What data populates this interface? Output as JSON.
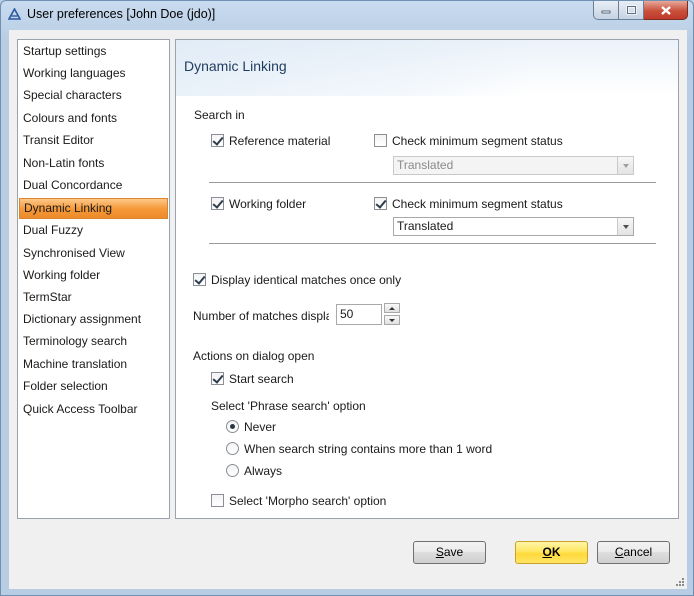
{
  "window": {
    "title": "User preferences [John Doe (jdo)]"
  },
  "sidebar": {
    "items": [
      {
        "label": "Startup settings",
        "selected": false
      },
      {
        "label": "Working languages",
        "selected": false
      },
      {
        "label": "Special characters",
        "selected": false
      },
      {
        "label": "Colours and fonts",
        "selected": false
      },
      {
        "label": "Transit Editor",
        "selected": false
      },
      {
        "label": "Non-Latin fonts",
        "selected": false
      },
      {
        "label": "Dual Concordance",
        "selected": false
      },
      {
        "label": "Dynamic Linking",
        "selected": true
      },
      {
        "label": "Dual Fuzzy",
        "selected": false
      },
      {
        "label": "Synchronised View",
        "selected": false
      },
      {
        "label": "Working folder",
        "selected": false
      },
      {
        "label": "TermStar",
        "selected": false
      },
      {
        "label": "Dictionary assignment",
        "selected": false
      },
      {
        "label": "Terminology search",
        "selected": false
      },
      {
        "label": "Machine translation",
        "selected": false
      },
      {
        "label": "Folder selection",
        "selected": false
      },
      {
        "label": "Quick Access Toolbar",
        "selected": false
      }
    ]
  },
  "panel": {
    "title": "Dynamic Linking",
    "search_in_label": "Search in",
    "reference_material": {
      "label": "Reference material",
      "checked": true
    },
    "ref_check_min": {
      "label": "Check minimum segment status",
      "checked": false
    },
    "ref_status": {
      "value": "Translated",
      "enabled": false
    },
    "working_folder": {
      "label": "Working folder",
      "checked": true
    },
    "wf_check_min": {
      "label": "Check minimum segment status",
      "checked": true
    },
    "wf_status": {
      "value": "Translated",
      "enabled": true
    },
    "display_identical": {
      "label": "Display identical matches once only",
      "checked": true
    },
    "num_matches": {
      "label": "Number of matches displayed",
      "value": "50"
    },
    "actions_label": "Actions on dialog open",
    "start_search": {
      "label": "Start search",
      "checked": true
    },
    "phrase_search_label": "Select 'Phrase search' option",
    "phrase_options": [
      {
        "label": "Never",
        "selected": true
      },
      {
        "label": "When search string contains more than 1 word",
        "selected": false
      },
      {
        "label": "Always",
        "selected": false
      }
    ],
    "morpho_search": {
      "label": "Select 'Morpho search' option",
      "checked": false
    }
  },
  "footer": {
    "save_mnemonic": "S",
    "save_rest": "ave",
    "ok_mnemonic": "O",
    "ok_rest": "K",
    "cancel_mnemonic": "C",
    "cancel_rest": "ancel"
  },
  "colors": {
    "selection": "#f59a3a",
    "ok_button": "#ffe660",
    "close_button": "#c8503a"
  }
}
